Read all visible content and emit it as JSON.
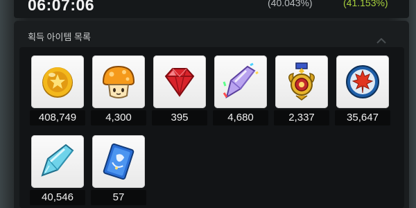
{
  "header": {
    "timer": "06:07:06",
    "rate_primary": "(40.043%)",
    "rate_secondary": "(41.153%)"
  },
  "panel": {
    "title": "획득 아이템 목록"
  },
  "items": [
    {
      "icon": "gold-coin-icon",
      "count": "408,749"
    },
    {
      "icon": "orange-mushroom-icon",
      "count": "4,300"
    },
    {
      "icon": "red-gem-icon",
      "count": "395"
    },
    {
      "icon": "rainbow-crystal-icon",
      "count": "4,680"
    },
    {
      "icon": "gold-medal-icon",
      "count": "2,337"
    },
    {
      "icon": "maple-leaf-coin-icon",
      "count": "35,647"
    },
    {
      "icon": "blue-crystal-icon",
      "count": "40,546"
    },
    {
      "icon": "blue-card-icon",
      "count": "57"
    }
  ],
  "colors": {
    "accent_green": "#a6cf3c",
    "tile_bg": "#f2f2f2",
    "panel_bg": "#1a1d1f"
  }
}
